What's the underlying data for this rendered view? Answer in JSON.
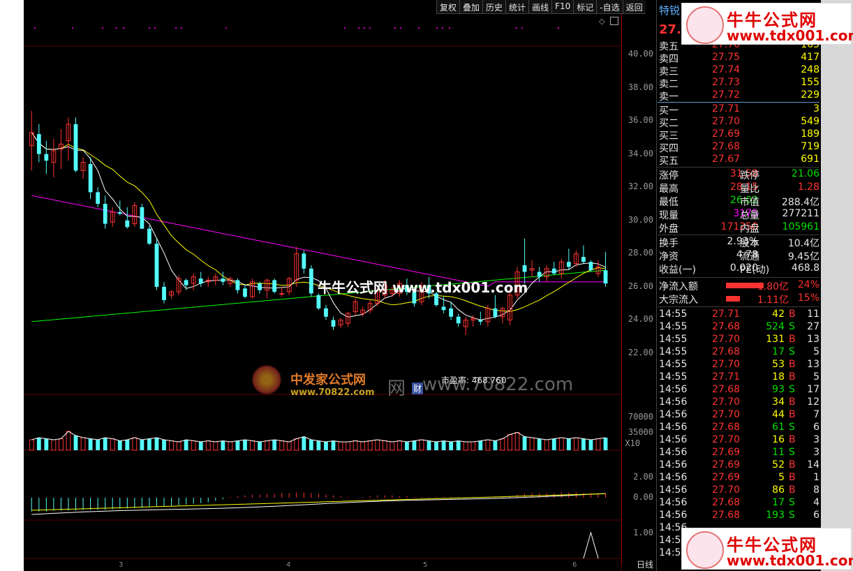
{
  "toolbar": {
    "buttons": [
      "复权",
      "叠加",
      "历史",
      "统计",
      "画线",
      "F10",
      "标记",
      "-自选",
      "返回"
    ]
  },
  "stock": {
    "name": "特锐",
    "price": "27."
  },
  "order_book": {
    "sell": [
      {
        "label": "卖五",
        "price": "27.76",
        "vol": "165"
      },
      {
        "label": "卖四",
        "price": "27.75",
        "vol": "417"
      },
      {
        "label": "卖三",
        "price": "27.74",
        "vol": "248"
      },
      {
        "label": "卖二",
        "price": "27.73",
        "vol": "155"
      },
      {
        "label": "卖一",
        "price": "27.72",
        "vol": "229"
      }
    ],
    "buy": [
      {
        "label": "买一",
        "price": "27.71",
        "vol": "3"
      },
      {
        "label": "买二",
        "price": "27.70",
        "vol": "549"
      },
      {
        "label": "买三",
        "price": "27.69",
        "vol": "189"
      },
      {
        "label": "买四",
        "price": "27.68",
        "vol": "719"
      },
      {
        "label": "买五",
        "price": "27.67",
        "vol": "691"
      }
    ]
  },
  "stats": [
    {
      "l1": "涨停",
      "v1": "31.58",
      "l2": "跌停",
      "v2": "21.06"
    },
    {
      "l1": "最高",
      "v1": "28.15",
      "l2": "量比",
      "v2": "1.28"
    },
    {
      "l1": "最低",
      "v1": "26.02",
      "l2": "市值",
      "v2": "288.4亿"
    },
    {
      "l1": "现量",
      "v1": "3175",
      "l2": "总量",
      "v2": "277211"
    },
    {
      "l1": "外盘",
      "v1": "171250",
      "l2": "内盘",
      "v2": "105961"
    },
    {
      "l1": "换手",
      "v1": "2.93%",
      "l2": "股本",
      "v2": "10.4亿"
    },
    {
      "l1": "净资",
      "v1": "4.78",
      "l2": "流通",
      "v2": "9.45亿"
    },
    {
      "l1": "收益(一)",
      "v1": "0.020",
      "l2": "PE(动)",
      "v2": "468.8"
    }
  ],
  "flow": [
    {
      "label": "净流入额",
      "value": "1.80亿",
      "pct": "24%"
    },
    {
      "label": "大宗流入",
      "value": "1.11亿",
      "pct": "15%"
    }
  ],
  "ticks": [
    {
      "t": "14:55",
      "p": "27.71",
      "v": "42",
      "d": "B",
      "n": "11"
    },
    {
      "t": "14:55",
      "p": "27.68",
      "v": "524",
      "d": "S",
      "n": "27"
    },
    {
      "t": "14:55",
      "p": "27.70",
      "v": "131",
      "d": "B",
      "n": "13"
    },
    {
      "t": "14:55",
      "p": "27.68",
      "v": "17",
      "d": "S",
      "n": "5"
    },
    {
      "t": "14:55",
      "p": "27.70",
      "v": "53",
      "d": "B",
      "n": "13"
    },
    {
      "t": "14:55",
      "p": "27.71",
      "v": "18",
      "d": "B",
      "n": "5"
    },
    {
      "t": "14:56",
      "p": "27.68",
      "v": "93",
      "d": "S",
      "n": "17"
    },
    {
      "t": "14:56",
      "p": "27.70",
      "v": "34",
      "d": "B",
      "n": "12"
    },
    {
      "t": "14:56",
      "p": "27.70",
      "v": "44",
      "d": "B",
      "n": "7"
    },
    {
      "t": "14:56",
      "p": "27.68",
      "v": "61",
      "d": "S",
      "n": "6"
    },
    {
      "t": "14:56",
      "p": "27.70",
      "v": "16",
      "d": "B",
      "n": "3"
    },
    {
      "t": "14:56",
      "p": "27.69",
      "v": "11",
      "d": "S",
      "n": "3"
    },
    {
      "t": "14:56",
      "p": "27.69",
      "v": "52",
      "d": "B",
      "n": "14"
    },
    {
      "t": "14:56",
      "p": "27.69",
      "v": "5",
      "d": "B",
      "n": "1"
    },
    {
      "t": "14:56",
      "p": "27.70",
      "v": "86",
      "d": "B",
      "n": "8"
    },
    {
      "t": "14:56",
      "p": "27.68",
      "v": "17",
      "d": "S",
      "n": "4"
    },
    {
      "t": "14:56",
      "p": "27.68",
      "v": "193",
      "d": "S",
      "n": "6"
    },
    {
      "t": "14:56",
      "p": "",
      "v": "",
      "d": "",
      "n": ""
    },
    {
      "t": "14:5",
      "p": "",
      "v": "",
      "d": "",
      "n": ""
    },
    {
      "t": "14:5",
      "p": "",
      "v": "",
      "d": "",
      "n": ""
    }
  ],
  "price_axis": [
    "40.00",
    "38.00",
    "36.00",
    "34.00",
    "32.00",
    "30.00",
    "28.00",
    "26.00",
    "24.00",
    "22.00"
  ],
  "volume_axis": [
    "70000",
    "35000",
    "X10"
  ],
  "macd_axis": [
    "2.00",
    "0.00"
  ],
  "bottom_axis": [
    "1.00"
  ],
  "x_labels": [
    "3",
    "4",
    "5",
    "6"
  ],
  "period_label": "日线",
  "pe_text": "市盈率: 468.760",
  "cai_badge": "财",
  "watermarks": {
    "brand": "牛牛公式网",
    "url": "www.tdx001.com",
    "center": "牛牛公式网 www.tdx001.com",
    "fazhan_cn": "中发家公式网",
    "fazhan_url": "www.70822.com",
    "fazhan_url_big": "www.70822.com",
    "wang": "网"
  },
  "colors": {
    "up": "#ff3232",
    "down": "#54fcfc",
    "ma5": "#ffffff",
    "ma10": "#ffff00",
    "ma60": "#ff00ff",
    "ma250": "#00ff00",
    "grid": "#5a0000"
  },
  "chart_data": {
    "type": "candlestick",
    "ylim": [
      21,
      41
    ],
    "candles": [
      [
        34.5,
        36.6,
        33.0,
        35.3
      ],
      [
        35.2,
        35.8,
        33.5,
        34.0
      ],
      [
        34.0,
        34.8,
        32.8,
        33.6
      ],
      [
        33.5,
        34.9,
        32.6,
        34.2
      ],
      [
        34.3,
        35.5,
        33.1,
        34.6
      ],
      [
        34.8,
        36.2,
        33.6,
        35.8
      ],
      [
        35.8,
        36.2,
        32.9,
        33.0
      ],
      [
        33.0,
        33.8,
        32.5,
        33.5
      ],
      [
        33.4,
        33.8,
        31.3,
        31.7
      ],
      [
        31.7,
        32.0,
        30.8,
        31.0
      ],
      [
        31.0,
        31.5,
        29.5,
        29.8
      ],
      [
        29.9,
        30.8,
        29.6,
        30.5
      ],
      [
        30.5,
        31.2,
        30.3,
        30.4
      ],
      [
        30.0,
        30.8,
        29.5,
        29.6
      ],
      [
        29.8,
        31.1,
        29.6,
        30.9
      ],
      [
        30.8,
        31.0,
        29.5,
        29.5
      ],
      [
        29.5,
        29.7,
        28.5,
        28.6
      ],
      [
        28.6,
        28.9,
        25.8,
        26.0
      ],
      [
        26.0,
        26.3,
        25.0,
        25.2
      ],
      [
        25.5,
        25.8,
        25.3,
        25.7
      ],
      [
        25.7,
        26.7,
        25.5,
        26.5
      ],
      [
        26.4,
        26.5,
        25.8,
        26.1
      ],
      [
        26.2,
        26.8,
        25.8,
        26.6
      ],
      [
        26.5,
        26.9,
        26.0,
        26.2
      ],
      [
        26.3,
        26.6,
        26.0,
        26.4
      ],
      [
        26.4,
        26.8,
        26.1,
        26.6
      ],
      [
        26.5,
        26.9,
        26.1,
        26.3
      ],
      [
        26.2,
        26.6,
        26.0,
        26.5
      ],
      [
        26.4,
        26.5,
        25.6,
        25.8
      ],
      [
        25.9,
        26.1,
        25.3,
        25.4
      ],
      [
        25.4,
        26.5,
        25.3,
        26.3
      ],
      [
        26.2,
        26.3,
        25.6,
        25.8
      ],
      [
        25.8,
        26.5,
        25.3,
        26.4
      ],
      [
        26.4,
        26.5,
        25.6,
        25.7
      ],
      [
        25.6,
        26.0,
        25.4,
        25.6
      ],
      [
        25.7,
        26.6,
        25.5,
        26.5
      ],
      [
        26.4,
        28.4,
        26.0,
        28.0
      ],
      [
        28.0,
        28.2,
        26.8,
        27.1
      ],
      [
        27.1,
        27.3,
        25.4,
        25.6
      ],
      [
        25.5,
        25.6,
        24.6,
        24.7
      ],
      [
        24.7,
        24.9,
        24.0,
        24.2
      ],
      [
        24.0,
        24.2,
        23.4,
        23.6
      ],
      [
        23.7,
        24.1,
        23.5,
        24.0
      ],
      [
        23.8,
        24.5,
        23.6,
        24.4
      ],
      [
        24.5,
        25.3,
        24.3,
        25.1
      ],
      [
        24.4,
        24.8,
        24.2,
        24.6
      ],
      [
        24.6,
        25.2,
        24.4,
        25.0
      ],
      [
        25.0,
        25.9,
        24.8,
        25.8
      ],
      [
        25.5,
        26.4,
        25.3,
        26.1
      ],
      [
        25.6,
        26.0,
        25.4,
        25.8
      ],
      [
        25.6,
        26.4,
        25.4,
        26.2
      ],
      [
        26.1,
        26.5,
        25.5,
        25.7
      ],
      [
        25.7,
        25.9,
        24.8,
        25.0
      ],
      [
        25.1,
        26.3,
        24.9,
        26.0
      ],
      [
        26.1,
        26.6,
        25.3,
        25.6
      ],
      [
        25.6,
        25.7,
        24.8,
        24.9
      ],
      [
        24.8,
        25.4,
        24.4,
        24.6
      ],
      [
        24.7,
        25.1,
        24.0,
        24.2
      ],
      [
        24.2,
        24.4,
        23.6,
        23.8
      ],
      [
        23.6,
        24.2,
        23.1,
        24.0
      ],
      [
        24.0,
        24.3,
        23.6,
        24.1
      ],
      [
        24.0,
        24.5,
        23.7,
        23.9
      ],
      [
        23.9,
        24.9,
        23.6,
        24.7
      ],
      [
        24.7,
        25.5,
        24.1,
        24.2
      ],
      [
        24.2,
        24.8,
        23.8,
        24.7
      ],
      [
        24.0,
        25.9,
        23.7,
        25.5
      ],
      [
        25.5,
        27.2,
        25.3,
        26.9
      ],
      [
        27.3,
        28.9,
        26.2,
        26.9
      ],
      [
        27.0,
        27.6,
        26.6,
        27.1
      ],
      [
        26.9,
        27.2,
        26.3,
        26.6
      ],
      [
        26.6,
        27.3,
        26.3,
        27.1
      ],
      [
        27.1,
        27.5,
        26.7,
        26.8
      ],
      [
        26.8,
        27.7,
        26.5,
        27.5
      ],
      [
        27.5,
        28.3,
        27.0,
        27.2
      ],
      [
        27.4,
        28.2,
        27.2,
        28.0
      ],
      [
        27.8,
        28.5,
        27.4,
        27.5
      ],
      [
        27.5,
        27.6,
        26.9,
        27.0
      ],
      [
        26.8,
        27.6,
        26.6,
        27.2
      ],
      [
        27.0,
        28.1,
        26.0,
        26.2
      ]
    ],
    "volumes": [
      0.5,
      0.6,
      0.55,
      0.5,
      0.55,
      0.9,
      0.7,
      0.6,
      0.55,
      0.5,
      0.6,
      0.55,
      0.45,
      0.5,
      0.6,
      0.5,
      0.55,
      0.6,
      0.5,
      0.45,
      0.4,
      0.5,
      0.45,
      0.4,
      0.45,
      0.4,
      0.45,
      0.4,
      0.45,
      0.5,
      0.45,
      0.4,
      0.45,
      0.5,
      0.45,
      0.4,
      0.55,
      0.65,
      0.5,
      0.45,
      0.4,
      0.45,
      0.4,
      0.4,
      0.45,
      0.4,
      0.45,
      0.5,
      0.45,
      0.4,
      0.45,
      0.4,
      0.45,
      0.5,
      0.45,
      0.4,
      0.45,
      0.4,
      0.45,
      0.4,
      0.4,
      0.45,
      0.5,
      0.45,
      0.55,
      0.75,
      0.85,
      0.65,
      0.6,
      0.55,
      0.5,
      0.55,
      0.6,
      0.55,
      0.6,
      0.55,
      0.5,
      0.55,
      0.6
    ],
    "macd_bars": [
      -0.9,
      -0.9,
      -0.9,
      -0.85,
      -0.85,
      -0.85,
      -0.85,
      -0.8,
      -0.8,
      -0.78,
      -0.78,
      -0.75,
      -0.72,
      -0.7,
      -0.68,
      -0.66,
      -0.62,
      -0.6,
      -0.58,
      -0.55,
      -0.5,
      -0.45,
      -0.4,
      -0.35,
      -0.3,
      -0.2,
      -0.1,
      0.05,
      0.1,
      0.15,
      0.2,
      0.2,
      0.25,
      0.25,
      0.3,
      0.3,
      0.35,
      0.35,
      0.3,
      0.25,
      0.2,
      0.15,
      0.1,
      0.05,
      0.0,
      0.05,
      0.1,
      0.15,
      0.15,
      0.15,
      0.1,
      0.1,
      0.05,
      0.05,
      0.05,
      0.05,
      0.05,
      0.05,
      0.05,
      0.05,
      0.05,
      0.05,
      0.05,
      0.05,
      0.05,
      0.1,
      0.2,
      0.25,
      0.3,
      0.3,
      0.3,
      0.3,
      0.35,
      0.35,
      0.35,
      0.3,
      0.3,
      0.3,
      0.3
    ]
  }
}
